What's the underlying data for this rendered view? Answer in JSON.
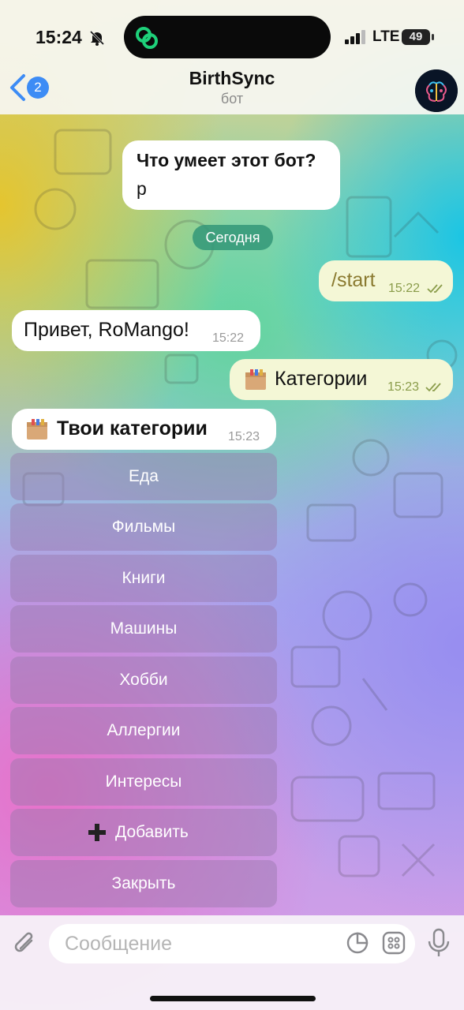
{
  "status_bar": {
    "time": "15:24",
    "network": "LTE",
    "battery": "49"
  },
  "header": {
    "back_badge": "2",
    "title": "BirthSync",
    "subtitle": "бот"
  },
  "messages": {
    "intro": {
      "line1": "Что умеет этот бот?",
      "line2": "р"
    },
    "date_separator": "Сегодня",
    "start": {
      "text": "/start",
      "time": "15:22"
    },
    "greeting": {
      "text": "Привет, RoMango!",
      "time": "15:22"
    },
    "categories_cmd": {
      "text": "Категории",
      "time": "15:23"
    },
    "your_categories": {
      "text": "Твои категории",
      "time": "15:23"
    }
  },
  "keyboard": {
    "buttons": [
      "Еда",
      "Фильмы",
      "Книги",
      "Машины",
      "Хобби",
      "Аллергии",
      "Интересы",
      "Добавить",
      "Закрыть"
    ]
  },
  "composer": {
    "placeholder": "Сообщение"
  },
  "icons": [
    "bell-slash-icon",
    "chevron-left-icon",
    "box-emoji-icon",
    "double-check-icon",
    "plus-icon",
    "paperclip-icon",
    "sticker-icon",
    "grid-icon",
    "microphone-icon"
  ]
}
